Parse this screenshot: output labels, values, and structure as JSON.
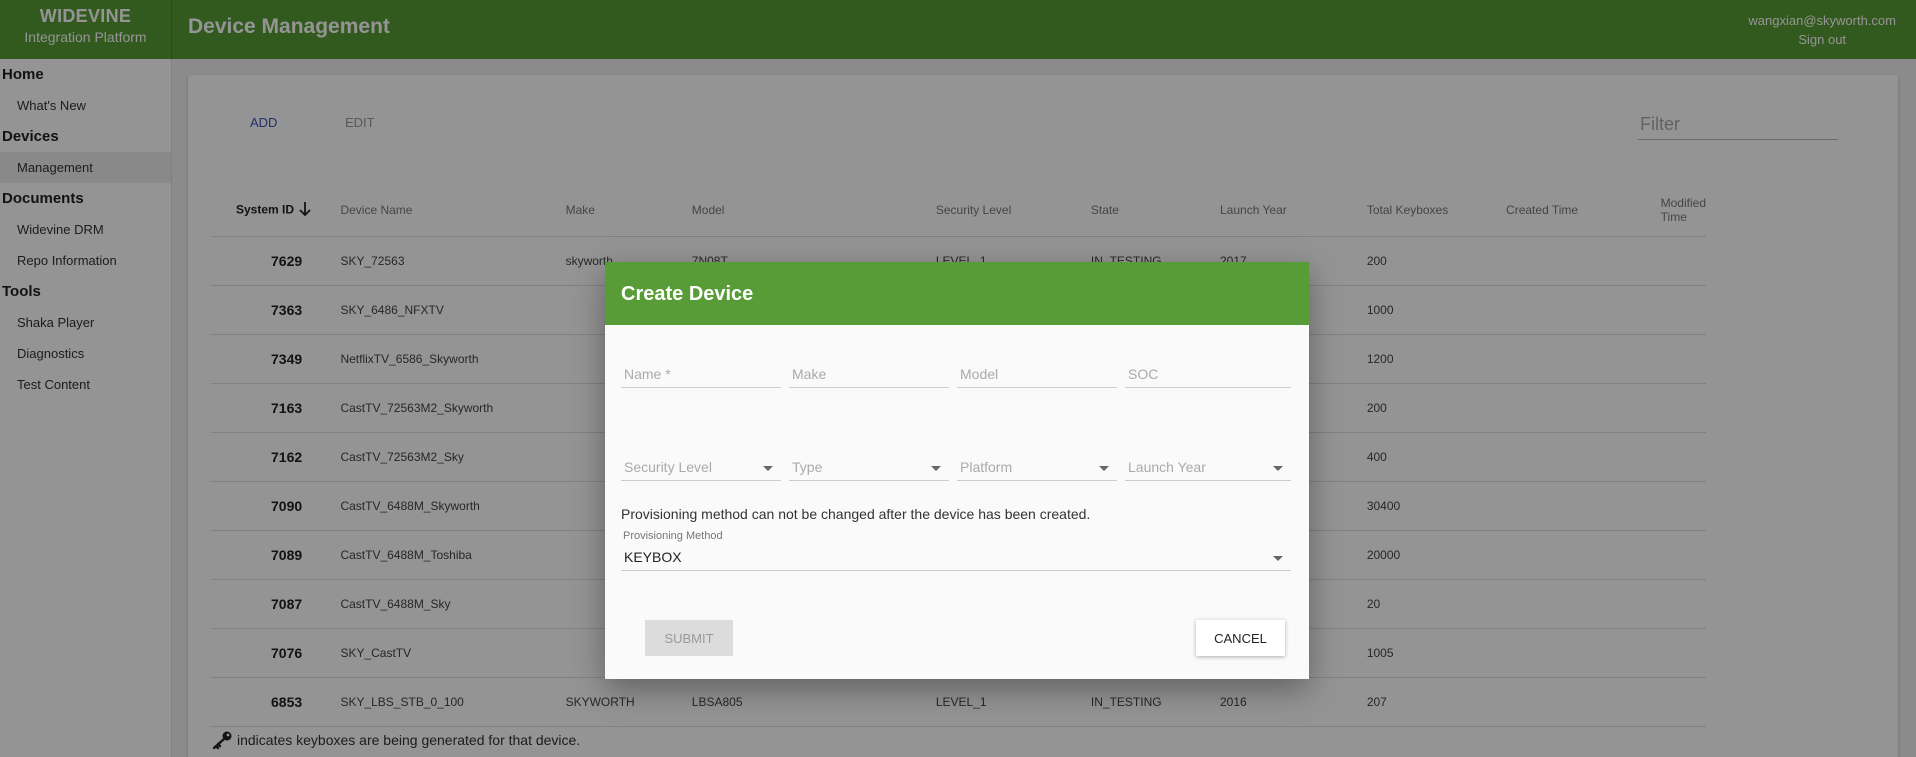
{
  "header": {
    "brand_title": "WIDEVINE",
    "brand_subtitle": "Integration Platform",
    "page_title": "Device Management",
    "user_email": "wangxian@skyworth.com",
    "sign_out": "Sign out",
    "color": "#579c36"
  },
  "sidebar": {
    "sections": [
      {
        "title": "Home",
        "items": [
          "What's New"
        ]
      },
      {
        "title": "Devices",
        "items": [
          "Management"
        ]
      },
      {
        "title": "Documents",
        "items": [
          "Widevine DRM",
          "Repo Information"
        ]
      },
      {
        "title": "Tools",
        "items": [
          "Shaka Player",
          "Diagnostics",
          "Test Content"
        ]
      }
    ],
    "active_item": "Management"
  },
  "toolbar": {
    "add_label": "ADD",
    "edit_label": "EDIT",
    "filter_placeholder": "Filter"
  },
  "table": {
    "columns": [
      "System ID",
      "Device Name",
      "Make",
      "Model",
      "Security Level",
      "State",
      "Launch Year",
      "Total Keyboxes",
      "Created Time",
      "Modified Time"
    ],
    "rows": [
      {
        "system_id": "7629",
        "device_name": "SKY_72563",
        "make": "skyworth",
        "model": "7N08T",
        "security_level": "LEVEL_1",
        "state": "IN_TESTING",
        "launch_year": "2017",
        "total_keyboxes": "200",
        "created": "",
        "modified": ""
      },
      {
        "system_id": "7363",
        "device_name": "SKY_6486_NFXTV",
        "make": "",
        "model": "",
        "security_level": "",
        "state": "",
        "launch_year": "",
        "total_keyboxes": "1000",
        "created": "",
        "modified": ""
      },
      {
        "system_id": "7349",
        "device_name": "NetflixTV_6586_Skyworth",
        "make": "",
        "model": "",
        "security_level": "",
        "state": "",
        "launch_year": "",
        "total_keyboxes": "1200",
        "created": "",
        "modified": ""
      },
      {
        "system_id": "7163",
        "device_name": "CastTV_72563M2_Skyworth",
        "make": "",
        "model": "",
        "security_level": "",
        "state": "",
        "launch_year": "",
        "total_keyboxes": "200",
        "created": "",
        "modified": ""
      },
      {
        "system_id": "7162",
        "device_name": "CastTV_72563M2_Sky",
        "make": "",
        "model": "",
        "security_level": "",
        "state": "",
        "launch_year": "",
        "total_keyboxes": "400",
        "created": "",
        "modified": ""
      },
      {
        "system_id": "7090",
        "device_name": "CastTV_6488M_Skyworth",
        "make": "",
        "model": "",
        "security_level": "",
        "state": "",
        "launch_year": "",
        "total_keyboxes": "30400",
        "created": "",
        "modified": ""
      },
      {
        "system_id": "7089",
        "device_name": "CastTV_6488M_Toshiba",
        "make": "",
        "model": "",
        "security_level": "",
        "state": "",
        "launch_year": "",
        "total_keyboxes": "20000",
        "created": "",
        "modified": ""
      },
      {
        "system_id": "7087",
        "device_name": "CastTV_6488M_Sky",
        "make": "",
        "model": "",
        "security_level": "",
        "state": "",
        "launch_year": "",
        "total_keyboxes": "20",
        "created": "",
        "modified": ""
      },
      {
        "system_id": "7076",
        "device_name": "SKY_CastTV",
        "make": "",
        "model": "",
        "security_level": "",
        "state": "",
        "launch_year": "",
        "total_keyboxes": "1005",
        "created": "",
        "modified": ""
      },
      {
        "system_id": "6853",
        "device_name": "SKY_LBS_STB_0_100",
        "make": "SKYWORTH",
        "model": "LBSA805",
        "security_level": "LEVEL_1",
        "state": "IN_TESTING",
        "launch_year": "2016",
        "total_keyboxes": "207",
        "created": "",
        "modified": ""
      }
    ],
    "sort_icon": "arrow-down-icon"
  },
  "footnote": {
    "icon": "key-icon",
    "text": "indicates keyboxes are being generated for that device."
  },
  "dialog": {
    "title": "Create Device",
    "name_placeholder": "Name *",
    "make_placeholder": "Make",
    "model_placeholder": "Model",
    "soc_placeholder": "SOC",
    "security_level_placeholder": "Security Level",
    "type_placeholder": "Type",
    "platform_placeholder": "Platform",
    "launch_year_placeholder": "Launch Year",
    "notice": "Provisioning method can not be changed after the device has been created.",
    "provisioning_label": "Provisioning Method",
    "provisioning_value": "KEYBOX",
    "submit_label": "SUBMIT",
    "cancel_label": "CANCEL"
  }
}
